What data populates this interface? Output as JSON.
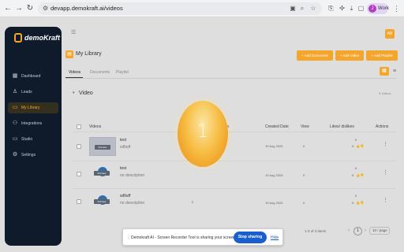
{
  "browser": {
    "url": "devapp.demokraft.ai/videos",
    "profile_initial": "J",
    "profile_label": "Work"
  },
  "brand": {
    "name": "demoKraft",
    "accent": "#f4a52b",
    "sidebar_bg": "#0f1a2b"
  },
  "sidebar": {
    "items": [
      {
        "label": "Dashboard",
        "icon": "grid-icon"
      },
      {
        "label": "Leads",
        "icon": "person-icon"
      },
      {
        "label": "My Library",
        "icon": "folder-icon",
        "active": true
      },
      {
        "label": "Integrations",
        "icon": "plug-icon"
      },
      {
        "label": "Studio",
        "icon": "monitor-icon"
      },
      {
        "label": "Settings",
        "icon": "gear-icon"
      }
    ]
  },
  "header": {
    "title": "My Library",
    "buttons": {
      "add_document": "+ Add Document",
      "add_video": "+ Add Video",
      "add_playlist": "+ Add Playlist"
    }
  },
  "tabs": [
    "Videos",
    "Documents",
    "Playlist"
  ],
  "table": {
    "section_title": "Video",
    "items_count": "3 Videos",
    "columns": [
      "Videos",
      "Tags",
      "Created Date",
      "View",
      "Likes/ dislikes",
      "Actions"
    ],
    "rows": [
      {
        "name": "test",
        "description": "sdfsdf",
        "thumb_badge": "Preview",
        "created": "19 Aug 2025",
        "views": "0",
        "likes": "0",
        "dislikes": "0"
      },
      {
        "name": "test",
        "description": "no description",
        "thumb_badge": "Preview",
        "created": "19 Aug 2025",
        "views": "0",
        "likes": "0",
        "dislikes": "0"
      },
      {
        "name": "sdfsdf",
        "description": "no description",
        "thumb_badge": "Preview",
        "tags": "0",
        "created": "19 Aug 2025",
        "views": "0",
        "likes": "0",
        "dislikes": "0"
      }
    ]
  },
  "pagination": {
    "summary": "1-3 of 3 items",
    "current_page": "1",
    "per_page": "10 / page"
  },
  "countdown": {
    "value": "1"
  },
  "share_bar": {
    "message": "Demokraft AI - Screen Recorder Tool is sharing your screen.",
    "stop_label": "Stop sharing",
    "hide_label": "Hide"
  }
}
